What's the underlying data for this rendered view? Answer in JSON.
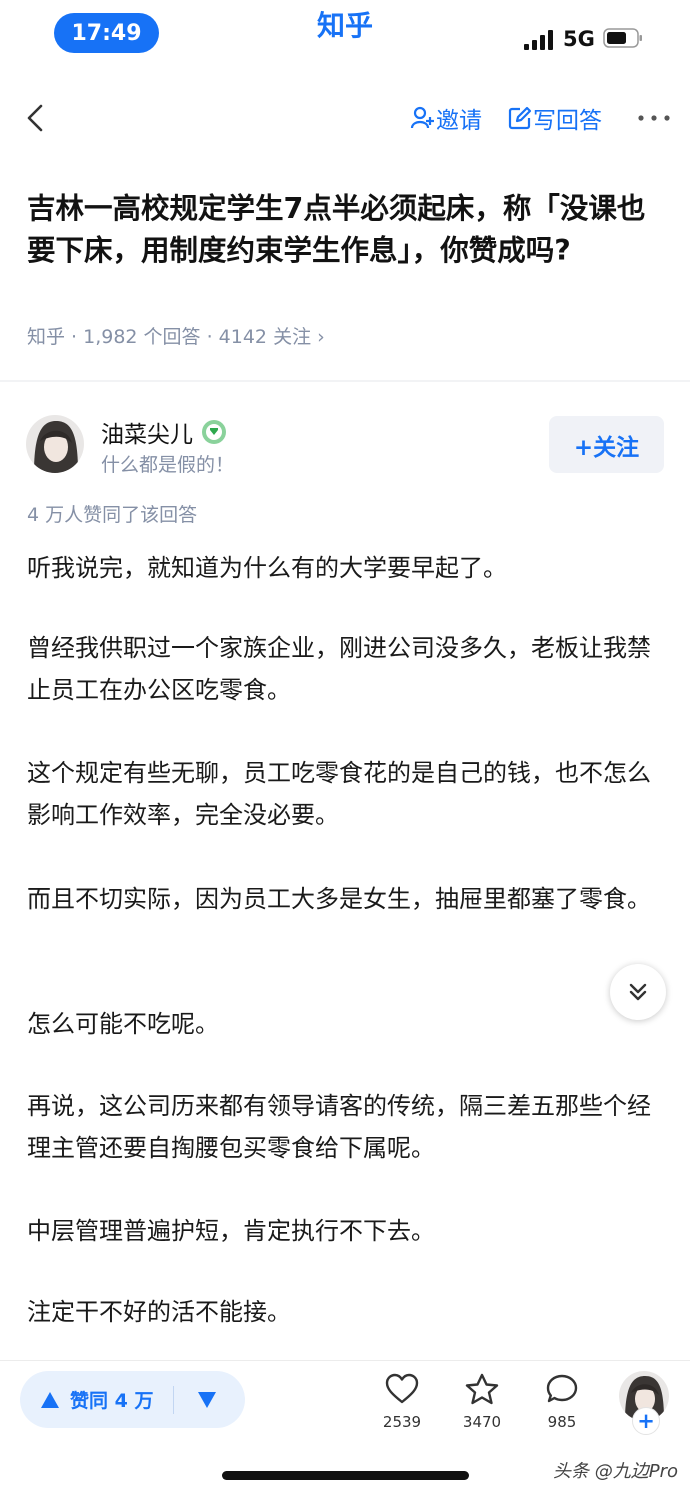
{
  "status_bar": {
    "time": "17:49",
    "app_name": "知乎",
    "network": "5G"
  },
  "nav": {
    "invite_label": "邀请",
    "write_label": "写回答",
    "back_icon": "chevron-left-icon",
    "more_icon": "more-icon"
  },
  "question": {
    "title": "吉林一高校规定学生7点半必须起床，称「没课也要下床，用制度约束学生作息」，你赞成吗?",
    "meta": "知乎 · 1,982 个回答 · 4142 关注 ›"
  },
  "author": {
    "name": "油菜尖儿",
    "bio": "什么都是假的！",
    "follow_label": "+关注"
  },
  "answer": {
    "approve_count": "4 万人赞同了该回答",
    "paragraphs": [
      "听我说完，就知道为什么有的大学要早起了。",
      "曾经我供职过一个家族企业，刚进公司没多久，老板让我禁止员工在办公区吃零食。",
      "这个规定有些无聊，员工吃零食花的是自己的钱，也不怎么影响工作效率，完全没必要。",
      "而且不切实际，因为员工大多是女生，抽屉里都塞了零食。",
      "怎么可能不吃呢。",
      "再说，这公司历来都有领导请客的传统，隔三差五那些个经理主管还要自掏腰包买零食给下属呢。",
      "中层管理普遍护短，肯定执行不下去。",
      "注定干不好的活不能接。"
    ]
  },
  "bottom_bar": {
    "upvote_label": "赞同 4 万",
    "like_count": "2539",
    "favorite_count": "3470",
    "comment_count": "985",
    "add_label": "+"
  },
  "watermark": "头条 @九边Pro",
  "colors": {
    "accent": "#1772f6",
    "meta_text": "#8590a6",
    "vote_bg": "#e8f1fd"
  }
}
